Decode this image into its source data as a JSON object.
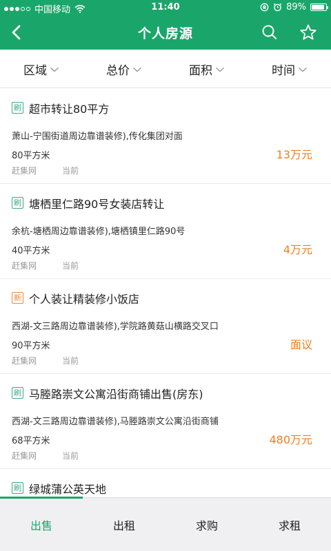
{
  "status_bar": {
    "carrier": "中国移动",
    "time": "11:40",
    "battery": "89%",
    "battery_level": 0.89
  },
  "nav": {
    "title": "个人房源",
    "back_icon": "chevron-left-icon",
    "search_icon": "search-icon",
    "favorite_icon": "star-icon"
  },
  "filters": [
    {
      "label": "区域"
    },
    {
      "label": "总价"
    },
    {
      "label": "面积"
    },
    {
      "label": "时间"
    }
  ],
  "listings": [
    {
      "tag": "刷",
      "tag_type": "refresh",
      "title": "超市转让80平方",
      "address": "萧山-宁围街道周边靠谱装修),传化集团对面",
      "area": "80平方米",
      "source": "赶集网",
      "time": "当前",
      "price": "13万元"
    },
    {
      "tag": "刷",
      "tag_type": "refresh",
      "title": "塘栖里仁路90号女装店转让",
      "address": "余杭-塘栖周边靠谱装修),塘栖镇里仁路90号",
      "area": "40平方米",
      "source": "赶集网",
      "time": "当前",
      "price": "4万元"
    },
    {
      "tag": "新",
      "tag_type": "new",
      "title": "个人装让精装修小饭店",
      "address": "西湖-文三路周边靠谱装修),学院路黄菇山横路交叉口",
      "area": "90平方米",
      "source": "赶集网",
      "time": "当前",
      "price": "面议"
    },
    {
      "tag": "刷",
      "tag_type": "refresh",
      "title": "马塍路崇文公寓沿街商铺出售(房东)",
      "address": "西湖-文三路周边靠谱装修),马塍路崇文公寓沿街商铺",
      "area": "68平方米",
      "source": "赶集网",
      "time": "当前",
      "price": "480万元"
    },
    {
      "tag": "刷",
      "tag_type": "refresh",
      "title": "绿城蒲公英天地",
      "address": "",
      "area": "",
      "source": "",
      "time": "",
      "price": ""
    }
  ],
  "tabs": [
    {
      "label": "出售",
      "active": true
    },
    {
      "label": "出租",
      "active": false
    },
    {
      "label": "求购",
      "active": false
    },
    {
      "label": "求租",
      "active": false
    }
  ],
  "colors": {
    "brand_green": "#1aa66a",
    "price_orange": "#ef7f1e",
    "tag_refresh": "#3aa98a",
    "tag_new": "#ee8a3a"
  }
}
